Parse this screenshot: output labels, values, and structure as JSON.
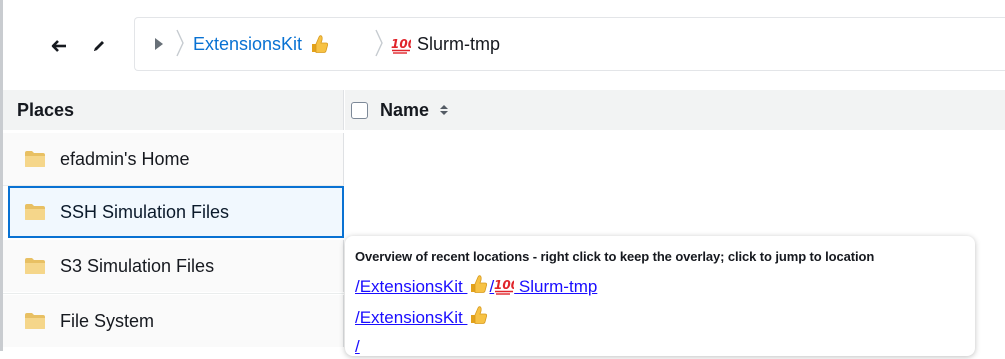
{
  "toolbar": {
    "back_icon": "arrow-left-icon",
    "edit_icon": "pencil-icon"
  },
  "breadcrumb": {
    "expand_icon": "triangle-right-icon",
    "items": [
      {
        "label": "ExtensionsKit",
        "emoji": "thumbs-up"
      },
      {
        "label": "Slurm-tmp",
        "emoji": "hundred-points"
      }
    ]
  },
  "places": {
    "header": "Places",
    "items": [
      {
        "label": "efadmin's Home",
        "selected": false
      },
      {
        "label": "SSH Simulation Files",
        "selected": true
      },
      {
        "label": "S3 Simulation Files",
        "selected": false
      },
      {
        "label": "File System",
        "selected": false
      }
    ]
  },
  "files": {
    "name_header": "Name"
  },
  "overlay": {
    "title": "Overview of recent locations - right click to keep the overlay; click to jump to location",
    "links": [
      {
        "text_a": "/ExtensionsKit ",
        "text_b": "/",
        "text_c": " Slurm-tmp"
      },
      {
        "text_a": "/ExtensionsKit "
      },
      {
        "text_a": "/"
      }
    ]
  },
  "colors": {
    "link": "#0972d3",
    "selected_border": "#0972d3",
    "overlay_link": "#1a0dff",
    "header_bg": "#f2f3f3"
  }
}
